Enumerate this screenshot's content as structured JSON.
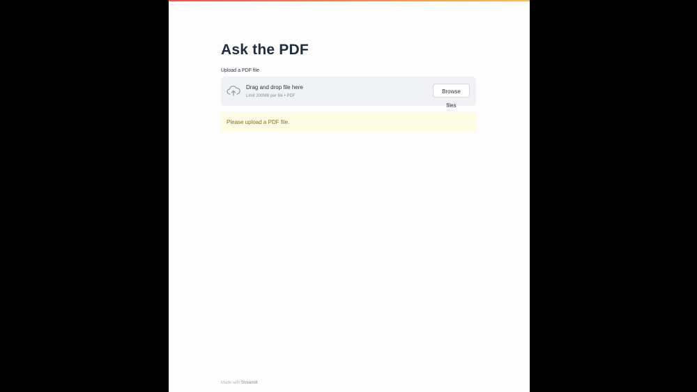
{
  "page": {
    "title": "Ask the PDF"
  },
  "uploader": {
    "label": "Upload a PDF file",
    "drop_text": "Drag and drop file here",
    "limit_text": "Limit 200MB per file • PDF",
    "browse_label": "Browse files",
    "icon": "cloud-upload-icon"
  },
  "alert": {
    "message": "Please upload a PDF file."
  },
  "footer": {
    "made_with": "Made with",
    "brand": "Streamlit"
  },
  "colors": {
    "accent_gradient_start": "#ff4b4b",
    "accent_gradient_end": "#ffbd45",
    "warning_bg": "#fffce4",
    "warning_text": "#8a6d1e"
  }
}
